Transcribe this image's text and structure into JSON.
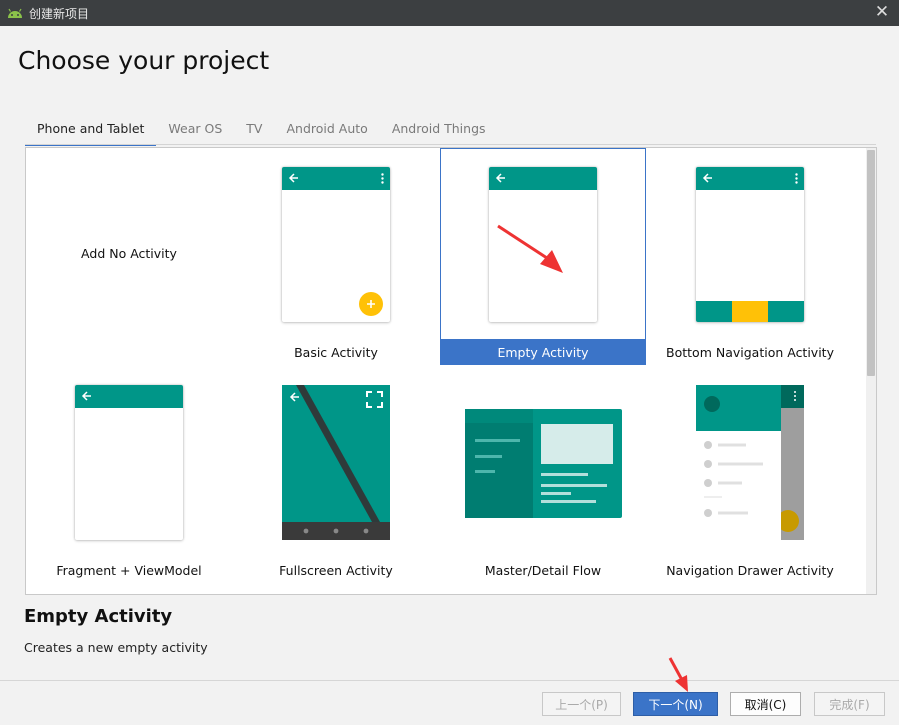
{
  "window": {
    "title": "创建新项目"
  },
  "heading": "Choose your project",
  "tabs": [
    {
      "label": "Phone and Tablet",
      "active": true
    },
    {
      "label": "Wear OS",
      "active": false
    },
    {
      "label": "TV",
      "active": false
    },
    {
      "label": "Android Auto",
      "active": false
    },
    {
      "label": "Android Things",
      "active": false
    }
  ],
  "templates": [
    {
      "label": "Add No Activity"
    },
    {
      "label": "Basic Activity"
    },
    {
      "label": "Empty Activity",
      "selected": true
    },
    {
      "label": "Bottom Navigation Activity"
    },
    {
      "label": "Fragment + ViewModel"
    },
    {
      "label": "Fullscreen Activity"
    },
    {
      "label": "Master/Detail Flow"
    },
    {
      "label": "Navigation Drawer Activity"
    }
  ],
  "selection": {
    "title": "Empty Activity",
    "description": "Creates a new empty activity"
  },
  "buttons": {
    "previous": "上一个(P)",
    "next": "下一个(N)",
    "cancel": "取消(C)",
    "finish": "完成(F)"
  },
  "colors": {
    "accent": "#3b74c8",
    "material_teal": "#009688",
    "fab_amber": "#ffc107",
    "annotation_arrow": "#ee3333"
  },
  "icons": [
    "android-icon",
    "close-icon",
    "back-arrow-icon",
    "more-vert-icon",
    "add-icon",
    "fullscreen-icon"
  ]
}
